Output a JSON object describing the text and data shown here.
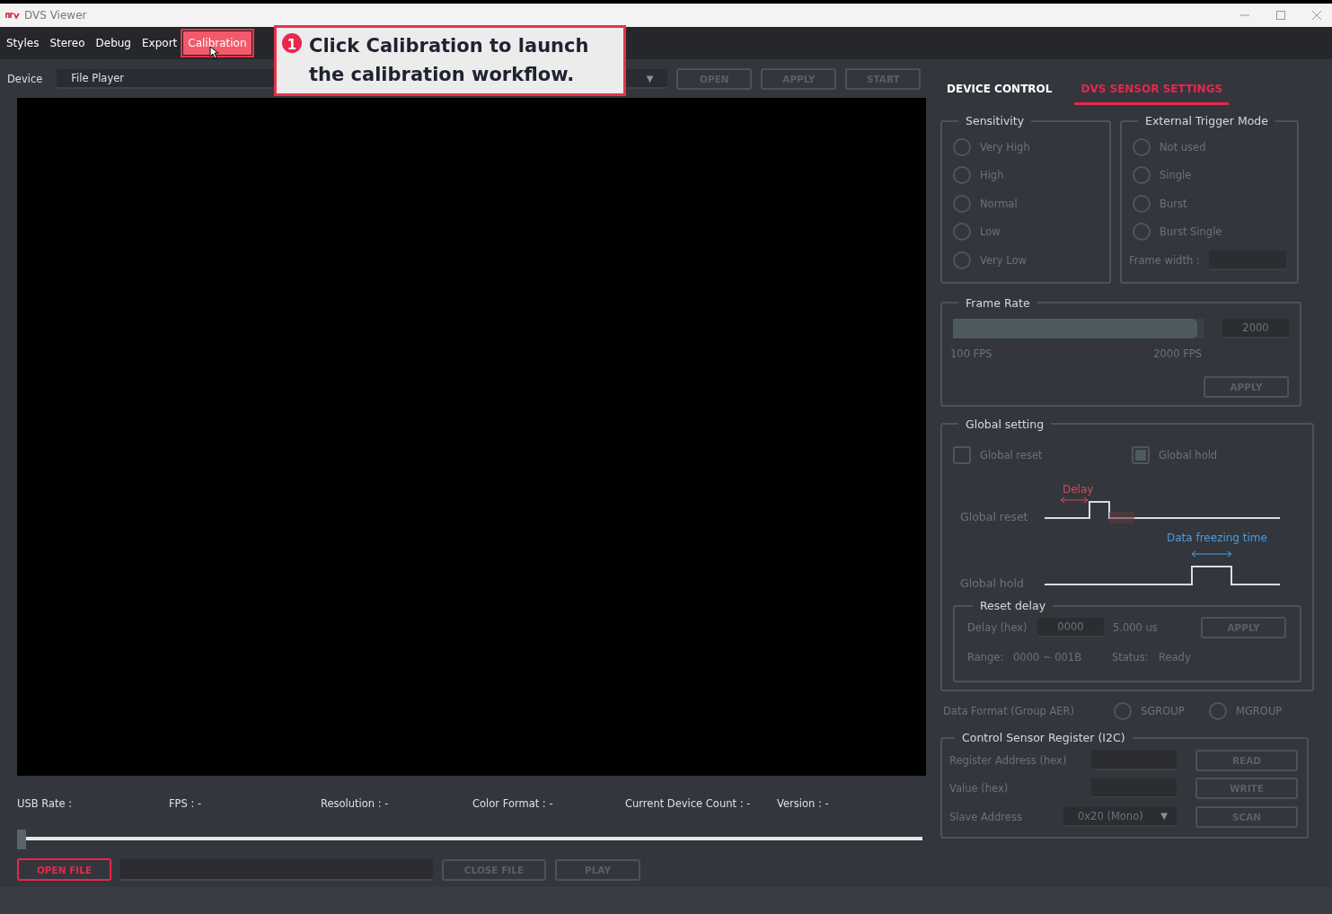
{
  "window": {
    "title": "DVS Viewer"
  },
  "menu": [
    {
      "label": "Styles",
      "selected": false
    },
    {
      "label": "Stereo",
      "selected": false
    },
    {
      "label": "Debug",
      "selected": false
    },
    {
      "label": "Export",
      "selected": false
    },
    {
      "label": "Calibration",
      "selected": true
    }
  ],
  "callout": {
    "badge": "1",
    "text": "Click Calibration to launch the calibration workflow."
  },
  "device": {
    "label": "Device",
    "value": "File Player",
    "caret": "▼"
  },
  "toolbar_buttons": [
    "OPEN",
    "APPLY",
    "START"
  ],
  "tabs": [
    {
      "label": "DEVICE CONTROL",
      "selected": false
    },
    {
      "label": "DVS SENSOR SETTINGS",
      "selected": true
    }
  ],
  "sensitivity": {
    "title": "Sensitivity",
    "options": [
      {
        "label": "Very High",
        "selected": false
      },
      {
        "label": "High",
        "selected": false
      },
      {
        "label": "Normal",
        "selected": false
      },
      {
        "label": "Low",
        "selected": false
      },
      {
        "label": "Very Low",
        "selected": false
      }
    ]
  },
  "trigger": {
    "title": "External Trigger Mode",
    "options": [
      {
        "label": "Not used",
        "selected": false
      },
      {
        "label": "Single",
        "selected": false
      },
      {
        "label": "Burst",
        "selected": false
      },
      {
        "label": "Burst Single",
        "selected": false
      }
    ],
    "frame_width_label": "Frame width :"
  },
  "frame_rate": {
    "title": "Frame Rate",
    "level": 0.97,
    "value": "2000",
    "min_label": "100 FPS",
    "max_label": "2000 FPS",
    "apply": "APPLY"
  },
  "global_setting": {
    "title": "Global setting",
    "checkboxes": [
      {
        "label": "Global reset",
        "checked": false
      },
      {
        "label": "Global hold",
        "checked": true
      }
    ],
    "diagram": {
      "reset_label": "Global reset",
      "hold_label": "Global hold",
      "delay_label": "Delay",
      "freeze_label": "Data freezing time"
    },
    "reset_delay": {
      "title": "Reset delay",
      "delay_label": "Delay (hex)",
      "delay_value": "0000",
      "delay_us": "5.000 us",
      "apply": "APPLY",
      "range_label": "Range:",
      "range_value": "0000 ~ 001B",
      "status_label": "Status:",
      "status_value": "Ready"
    }
  },
  "data_format": {
    "label": "Data Format (Group AER)",
    "options": [
      {
        "label": "SGROUP",
        "selected": false
      },
      {
        "label": "MGROUP",
        "selected": false
      }
    ]
  },
  "register": {
    "title": "Control Sensor Register (I2C)",
    "address_label": "Register Address (hex)",
    "value_label": "Value (hex)",
    "slave_label": "Slave Address",
    "slave_value": "0x20 (Mono)",
    "slave_caret": "▼",
    "buttons": [
      "READ",
      "WRITE",
      "SCAN"
    ]
  },
  "status": [
    "USB Rate :",
    "FPS : -",
    "Resolution : -",
    "Color Format : -",
    "Current Device Count : -",
    "Version : -"
  ],
  "playback": {
    "level": 0.0
  },
  "file_buttons": {
    "open": "OPEN FILE",
    "close": "CLOSE FILE",
    "play": "PLAY"
  }
}
